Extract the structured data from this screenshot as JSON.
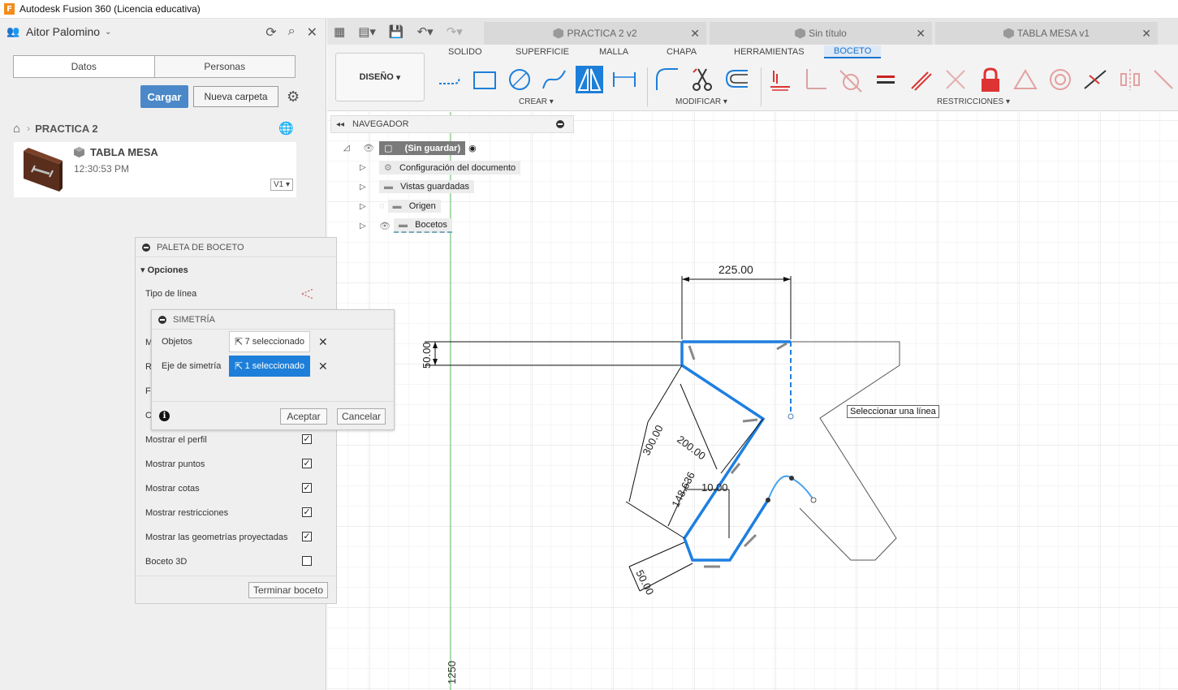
{
  "window": {
    "title": "Autodesk Fusion 360 (Licencia educativa)"
  },
  "data_panel": {
    "user": "Aitor Palomino",
    "tabs": [
      "Datos",
      "Personas"
    ],
    "upload_label": "Cargar",
    "new_folder_label": "Nueva carpeta",
    "breadcrumb": "PRACTICA 2",
    "file": {
      "name": "TABLA MESA",
      "time": "12:30:53 PM",
      "version": "V1"
    }
  },
  "doc_tabs": [
    {
      "label": "PRACTICA 2 v2"
    },
    {
      "label": "Sin título"
    },
    {
      "label": "TABLA MESA v1"
    }
  ],
  "ribbon": {
    "workspace": "DISEÑO",
    "tabs": [
      "SOLIDO",
      "SUPERFICIE",
      "MALLA",
      "CHAPA",
      "HERRAMIENTAS",
      "BOCETO"
    ],
    "groups": [
      "CREAR",
      "MODIFICAR",
      "RESTRICCIONES"
    ]
  },
  "navigator": {
    "title": "NAVEGADOR",
    "root": "(Sin guardar)",
    "items": [
      "Configuración del documento",
      "Vistas guardadas",
      "Origen",
      "Bocetos"
    ]
  },
  "palette": {
    "title": "PALETA DE BOCETO",
    "section": "Opciones",
    "line_type": "Tipo de línea",
    "hidden_letters": [
      "M",
      "R",
      "F",
      "C"
    ],
    "options": [
      {
        "label": "Mostrar el perfil",
        "checked": true
      },
      {
        "label": "Mostrar puntos",
        "checked": true
      },
      {
        "label": "Mostrar cotas",
        "checked": true
      },
      {
        "label": "Mostrar restricciones",
        "checked": true
      },
      {
        "label": "Mostrar las geometrías proyectadas",
        "checked": true
      },
      {
        "label": "Boceto 3D",
        "checked": false
      }
    ],
    "finish_label": "Terminar boceto"
  },
  "symmetry": {
    "title": "SIMETRÍA",
    "objects_label": "Objetos",
    "objects_value": "7 seleccionado",
    "axis_label": "Eje de simetría",
    "axis_value": "1 seleccionado",
    "ok_label": "Aceptar",
    "cancel_label": "Cancelar"
  },
  "tooltip": "Seleccionar una línea",
  "dimensions": {
    "top_width": "225.00",
    "left_height": "50.00",
    "diag_long": "300.00",
    "diag_mid": "200.00",
    "diag_short": "148.636",
    "small": "10.00",
    "bottom": "50.00",
    "ruler": "1250"
  },
  "colors": {
    "accent": "#1d7fd9",
    "sketch_selected": "#1e7fe0",
    "axis_green": "#5cb85c"
  }
}
